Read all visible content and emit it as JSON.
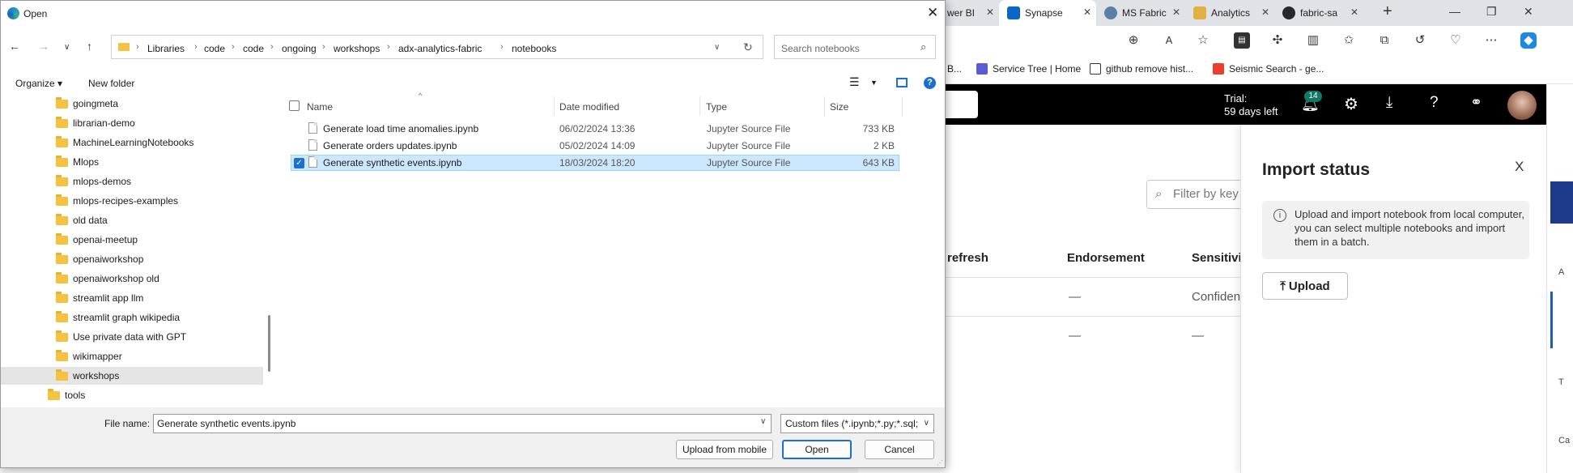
{
  "browser": {
    "tabs": [
      {
        "label": "wer BI",
        "color": "#f2c811"
      },
      {
        "label": "Synapse",
        "color": "#0b66c3"
      },
      {
        "label": "MS Fabric",
        "color": "#5b7fa6"
      },
      {
        "label": "Analytics",
        "color": "#e0b040"
      },
      {
        "label": "fabric-sa",
        "color": "#24292f"
      }
    ],
    "new_tab": "+",
    "favorites": [
      {
        "label": "B...",
        "color": "#2f6fd0"
      },
      {
        "label": "Service Tree | Home",
        "color": "#5b5bd6"
      },
      {
        "label": "github remove hist...",
        "color": "#ffffff"
      },
      {
        "label": "Seismic Search - ge...",
        "color": "#e8402c"
      }
    ]
  },
  "fabric": {
    "trial_label": "Trial:",
    "trial_days": "59 days left",
    "notif_count": "14",
    "filter_placeholder": "Filter by key",
    "columns": [
      "refresh",
      "Endorsement",
      "Sensitivit"
    ],
    "rows": [
      {
        "endorsement": "—",
        "sensitivity": "Confiden"
      },
      {
        "endorsement": "—",
        "sensitivity": "—"
      }
    ],
    "right_strip": [
      "A",
      "T",
      "Ca"
    ]
  },
  "import_panel": {
    "title": "Import status",
    "close": "X",
    "info_icon": "i",
    "info_text": "Upload and import notebook from local computer, you can select multiple notebooks and import them in a batch.",
    "upload_label": "Upload",
    "upload_icon": "⤒"
  },
  "dialog": {
    "title": "Open",
    "close": "✕",
    "breadcrumb": [
      "Libraries",
      "code",
      "code",
      "ongoing",
      "workshops",
      "adx-analytics-fabric",
      "notebooks"
    ],
    "search_placeholder": "Search notebooks",
    "organize_label": "Organize ▾",
    "new_folder_label": "New folder",
    "tree": [
      {
        "label": "goingmeta",
        "selected": false
      },
      {
        "label": "librarian-demo",
        "selected": false
      },
      {
        "label": "MachineLearningNotebooks",
        "selected": false
      },
      {
        "label": "Mlops",
        "selected": false
      },
      {
        "label": "mlops-demos",
        "selected": false
      },
      {
        "label": "mlops-recipes-examples",
        "selected": false
      },
      {
        "label": "old data",
        "selected": false
      },
      {
        "label": "openai-meetup",
        "selected": false
      },
      {
        "label": "openaiworkshop",
        "selected": false
      },
      {
        "label": "openaiworkshop old",
        "selected": false
      },
      {
        "label": "streamlit app llm",
        "selected": false
      },
      {
        "label": "streamlit graph wikipedia",
        "selected": false
      },
      {
        "label": "Use private data with GPT",
        "selected": false
      },
      {
        "label": "wikimapper",
        "selected": false
      },
      {
        "label": "workshops",
        "selected": true
      },
      {
        "label": "tools",
        "selected": false
      }
    ],
    "columns": {
      "name": "Name",
      "date": "Date modified",
      "type": "Type",
      "size": "Size"
    },
    "files": [
      {
        "name": "Generate load time anomalies.ipynb",
        "date": "06/02/2024 13:36",
        "type": "Jupyter Source File",
        "size": "733 KB",
        "selected": false
      },
      {
        "name": "Generate orders updates.ipynb",
        "date": "05/02/2024 14:09",
        "type": "Jupyter Source File",
        "size": "2 KB",
        "selected": false
      },
      {
        "name": "Generate synthetic events.ipynb",
        "date": "18/03/2024 18:20",
        "type": "Jupyter Source File",
        "size": "643 KB",
        "selected": true
      }
    ],
    "file_name_label": "File name:",
    "file_name_value": "Generate synthetic events.ipynb",
    "filter_value": "Custom files (*.ipynb;*.py;*.sql;",
    "upload_mobile_label": "Upload from mobile",
    "open_label": "Open",
    "cancel_label": "Cancel"
  }
}
